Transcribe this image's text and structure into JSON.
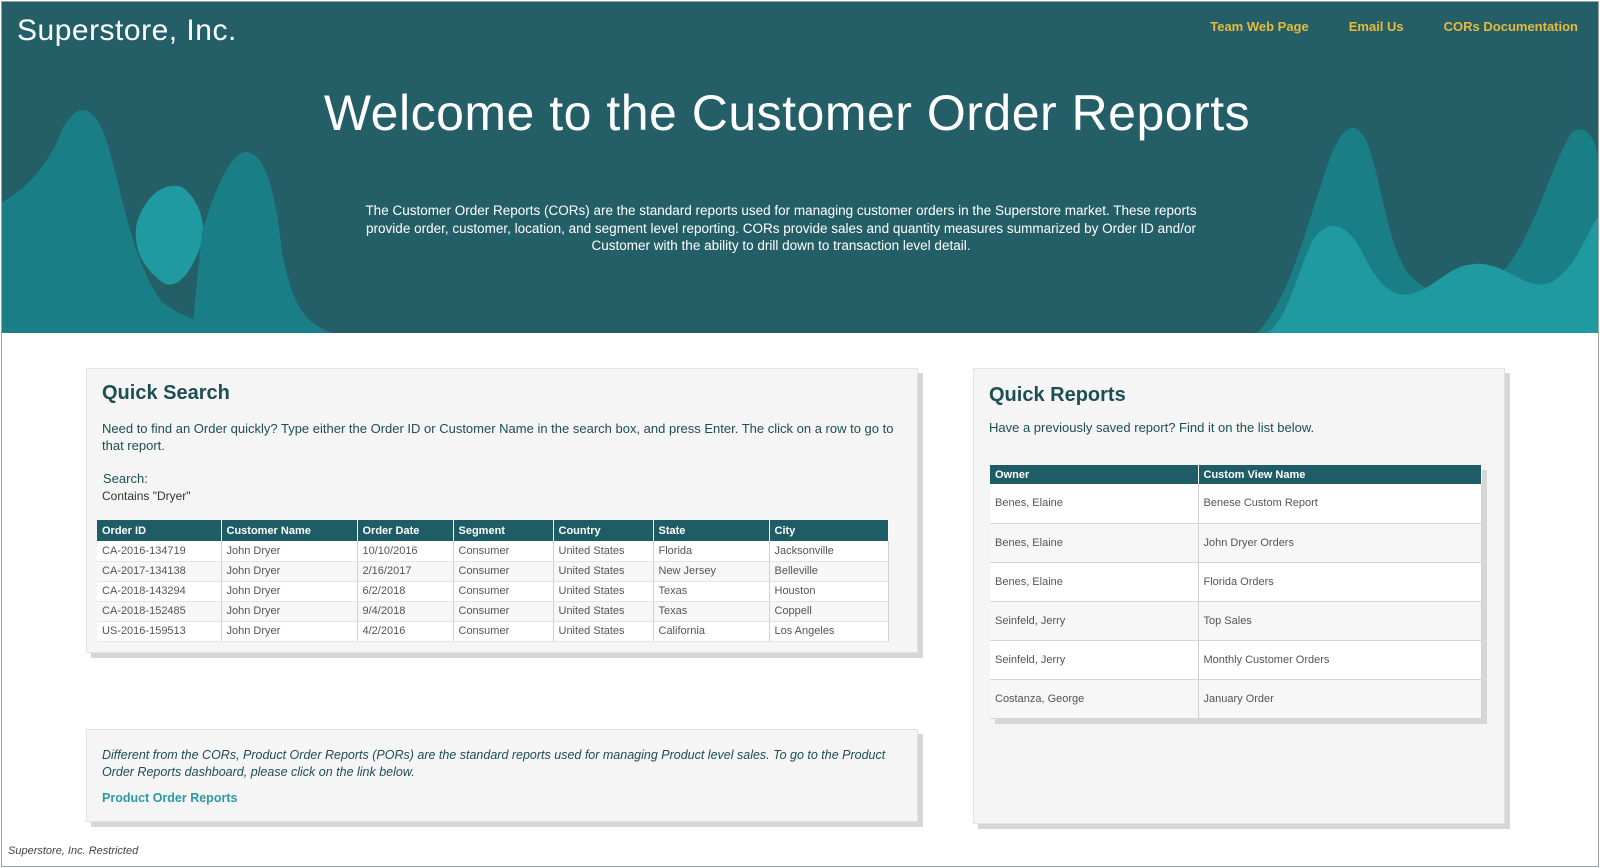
{
  "colors": {
    "header_bg": "#245f68",
    "wave_light": "#1f9aa0",
    "wave_mid": "#1a7e86",
    "nav_link": "#e8b93a",
    "table_header": "#1f5d66",
    "link": "#2a9aa5"
  },
  "header": {
    "brand": "Superstore, Inc.",
    "nav": [
      {
        "label": "Team Web Page"
      },
      {
        "label": "Email Us"
      },
      {
        "label": "CORs Documentation"
      }
    ],
    "title": "Welcome to the Customer Order Reports",
    "description": "The Customer Order Reports (CORs) are the standard reports used for managing customer orders in the Superstore market. These reports provide order, customer, location, and segment level reporting. CORs provide sales and quantity measures summarized by Order ID and/or Customer with the ability to drill down to transaction level detail."
  },
  "quick_search": {
    "title": "Quick Search",
    "intro": "Need to find an Order quickly? Type either the Order ID or Customer Name in the search box, and press Enter. The click on a row to go to that report.",
    "search_label": "Search:",
    "search_value": "Contains \"Dryer\"",
    "columns": [
      "Order ID",
      "Customer Name",
      "Order Date",
      "Segment",
      "Country",
      "State",
      "City"
    ],
    "rows": [
      [
        "CA-2016-134719",
        "John Dryer",
        "10/10/2016",
        "Consumer",
        "United States",
        "Florida",
        "Jacksonville"
      ],
      [
        "CA-2017-134138",
        "John Dryer",
        "2/16/2017",
        "Consumer",
        "United States",
        "New Jersey",
        "Belleville"
      ],
      [
        "CA-2018-143294",
        "John Dryer",
        "6/2/2018",
        "Consumer",
        "United States",
        "Texas",
        "Houston"
      ],
      [
        "CA-2018-152485",
        "John Dryer",
        "9/4/2018",
        "Consumer",
        "United States",
        "Texas",
        "Coppell"
      ],
      [
        "US-2016-159513",
        "John Dryer",
        "4/2/2016",
        "Consumer",
        "United States",
        "California",
        "Los Angeles"
      ]
    ]
  },
  "product_reports": {
    "note": "Different from the CORs, Product Order Reports (PORs) are the standard reports used for managing Product level sales. To go to the Product Order Reports dashboard, please click on the link below.",
    "link": "Product Order Reports"
  },
  "quick_reports": {
    "title": "Quick Reports",
    "intro": "Have a previously saved report? Find it on the list below.",
    "columns": [
      "Owner",
      "Custom View Name"
    ],
    "rows": [
      [
        "Benes, Elaine",
        "Benese Custom Report"
      ],
      [
        "Benes, Elaine",
        "John Dryer Orders"
      ],
      [
        "Benes, Elaine",
        "Florida Orders"
      ],
      [
        "Seinfeld, Jerry",
        "Top Sales"
      ],
      [
        "Seinfeld, Jerry",
        "Monthly Customer Orders"
      ],
      [
        "Costanza, George",
        "January Order"
      ]
    ]
  },
  "footer": "Superstore, Inc. Restricted"
}
